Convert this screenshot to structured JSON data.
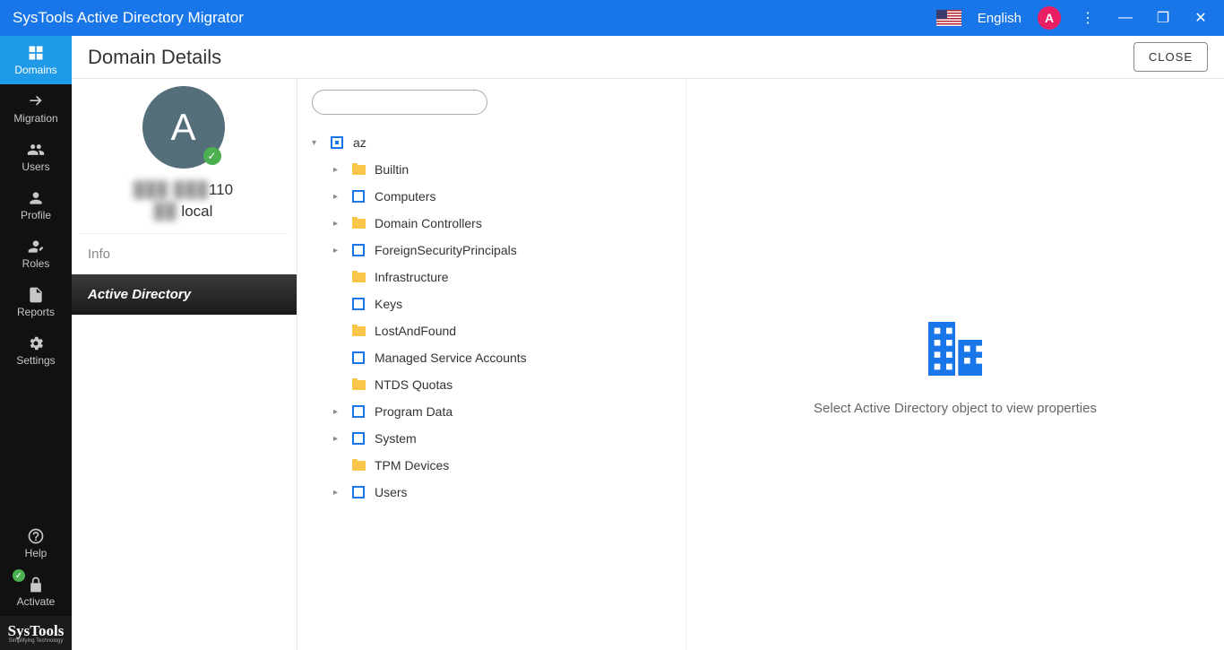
{
  "titlebar": {
    "title": "SysTools Active Directory Migrator",
    "language": "English",
    "avatar_letter": "A"
  },
  "sidebar": {
    "items": [
      {
        "label": "Domains",
        "icon": "domains-icon",
        "active": true
      },
      {
        "label": "Migration",
        "icon": "migration-icon"
      },
      {
        "label": "Users",
        "icon": "users-icon"
      },
      {
        "label": "Profile",
        "icon": "profile-icon"
      },
      {
        "label": "Roles",
        "icon": "roles-icon"
      },
      {
        "label": "Reports",
        "icon": "reports-icon"
      },
      {
        "label": "Settings",
        "icon": "settings-icon"
      }
    ],
    "bottom_items": [
      {
        "label": "Help",
        "icon": "help-icon"
      },
      {
        "label": "Activate",
        "icon": "activate-icon"
      }
    ],
    "brand": "SysTools",
    "brand_sub": "Simplifying Technology"
  },
  "header": {
    "title": "Domain Details",
    "close_label": "CLOSE"
  },
  "domain_profile": {
    "avatar_letter": "A",
    "line1_blur": "███ ███",
    "line1_suffix": "110",
    "line2_blur": "██",
    "line2_suffix": " local",
    "tabs": [
      {
        "label": "Info",
        "active": false
      },
      {
        "label": "Active Directory",
        "active": true
      }
    ]
  },
  "tree": {
    "root": {
      "label": "az",
      "icon": "org"
    },
    "children": [
      {
        "label": "Builtin",
        "icon": "folder",
        "expandable": true
      },
      {
        "label": "Computers",
        "icon": "container",
        "expandable": true
      },
      {
        "label": "Domain Controllers",
        "icon": "folder",
        "expandable": true
      },
      {
        "label": "ForeignSecurityPrincipals",
        "icon": "container",
        "expandable": true
      },
      {
        "label": "Infrastructure",
        "icon": "folder",
        "expandable": false
      },
      {
        "label": "Keys",
        "icon": "container",
        "expandable": false
      },
      {
        "label": "LostAndFound",
        "icon": "folder",
        "expandable": false
      },
      {
        "label": "Managed Service Accounts",
        "icon": "container",
        "expandable": false
      },
      {
        "label": "NTDS Quotas",
        "icon": "folder",
        "expandable": false
      },
      {
        "label": "Program Data",
        "icon": "container",
        "expandable": true
      },
      {
        "label": "System",
        "icon": "container",
        "expandable": true
      },
      {
        "label": "TPM Devices",
        "icon": "folder",
        "expandable": false
      },
      {
        "label": "Users",
        "icon": "container",
        "expandable": true
      }
    ]
  },
  "right_panel": {
    "message": "Select Active Directory object to view properties"
  },
  "search": {
    "placeholder": ""
  }
}
